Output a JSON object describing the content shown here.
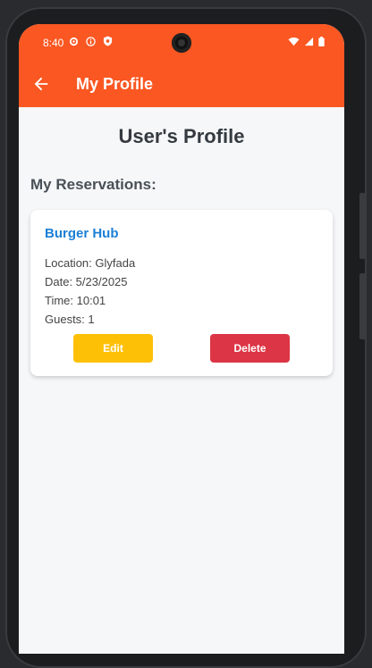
{
  "status": {
    "time": "8:40",
    "left_icons": [
      "gear-icon",
      "info-icon",
      "shield-icon"
    ],
    "right_icons": [
      "wifi-icon",
      "signal-icon",
      "battery-icon"
    ]
  },
  "appbar": {
    "title": "My Profile",
    "back_icon": "arrow-left-icon"
  },
  "page": {
    "title": "User's Profile",
    "section_title": "My Reservations:"
  },
  "reservations": [
    {
      "name": "Burger Hub",
      "location": "Location: Glyfada",
      "date": "Date: 5/23/2025",
      "time": "Time: 10:01",
      "guests": "Guests: 1",
      "edit_label": "Edit",
      "delete_label": "Delete"
    }
  ],
  "colors": {
    "primary": "#fa5722",
    "edit": "#fec007",
    "delete": "#dc3545",
    "link": "#1a7fd6",
    "background": "#f6f7f9"
  }
}
